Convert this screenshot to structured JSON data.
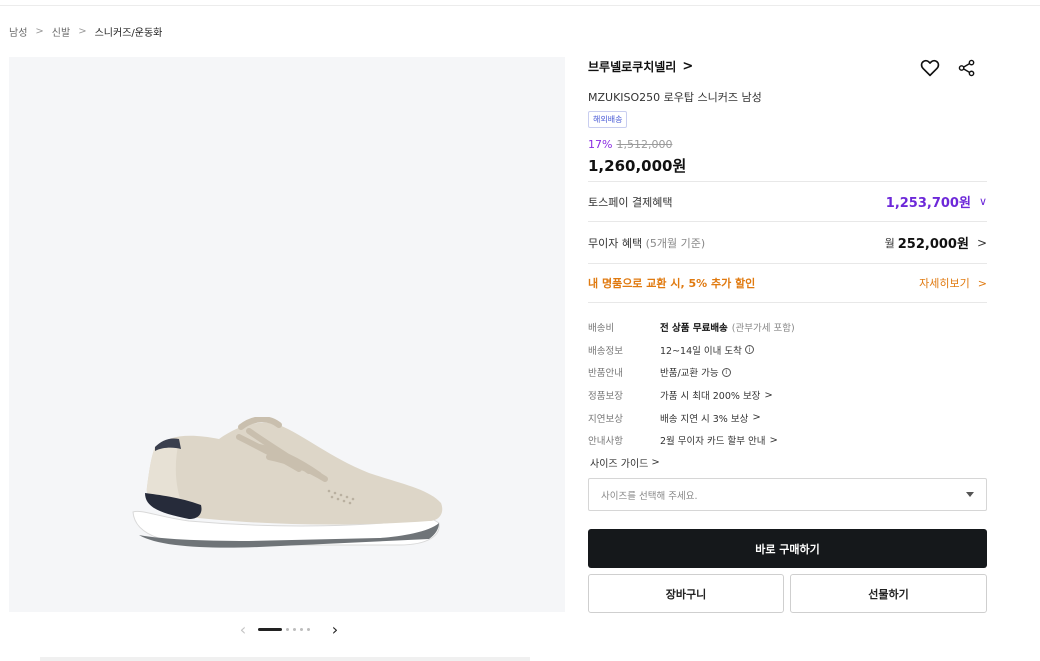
{
  "breadcrumb": {
    "items": [
      "남성",
      "신발",
      "스니커즈/운동화"
    ],
    "separator": ">"
  },
  "gallery": {
    "image_alt": "sneaker-product-image",
    "pager": {
      "prev": "‹",
      "next": "›",
      "total": 6,
      "active": 1
    }
  },
  "product": {
    "brand": "브루넬로쿠치넬리",
    "brand_chevron": ">",
    "name": "MZUKISO250 로우탑 스니커즈 남성",
    "badge": "해외배송",
    "discount": "17%",
    "original_price": "1,512,000",
    "final_price": "1,260,000원"
  },
  "benefits": {
    "toss_label": "토스페이 결제혜택",
    "toss_value": "1,253,700원",
    "toss_chevron": "∨",
    "muja_label": "무이자 혜택",
    "muja_sub": "(5개월 기준)",
    "muja_currency": "월",
    "muja_value": "252,000원",
    "chevron": ">",
    "promo_text": "내 명품으로 교환 시, 5% 추가 할인",
    "promo_more": "자세히보기"
  },
  "specs": [
    {
      "key": "배송비",
      "bold": "전 상품 무료배송",
      "value": "(관부가세 포함)"
    },
    {
      "key": "배송정보",
      "value": "12~14일 이내 도착",
      "info": "i"
    },
    {
      "key": "반품안내",
      "value": "반품/교환 가능",
      "info": "i"
    },
    {
      "key": "정품보장",
      "value": "가품 시 최대 200% 보장",
      "arrow": ">"
    },
    {
      "key": "지연보상",
      "value": "배송 지연 시 3% 보상",
      "arrow": ">"
    },
    {
      "key": "안내사항",
      "value": "2월 무이자 카드 할부 안내",
      "arrow": ">"
    }
  ],
  "size": {
    "guide_label": "사이즈 가이드",
    "guide_arrow": ">",
    "select_placeholder": "사이즈를 선택해 주세요."
  },
  "buttons": {
    "buy": "바로 구매하기",
    "cart": "장바구니",
    "gift": "선물하기"
  },
  "colors": {
    "toss_purple": "#6d28d9",
    "promo_orange": "#e07a10",
    "buy_bg": "#15181b",
    "gallery_bg": "#f5f6f8"
  },
  "icons": {
    "wishlist": "heart-icon",
    "share": "share-icon"
  }
}
